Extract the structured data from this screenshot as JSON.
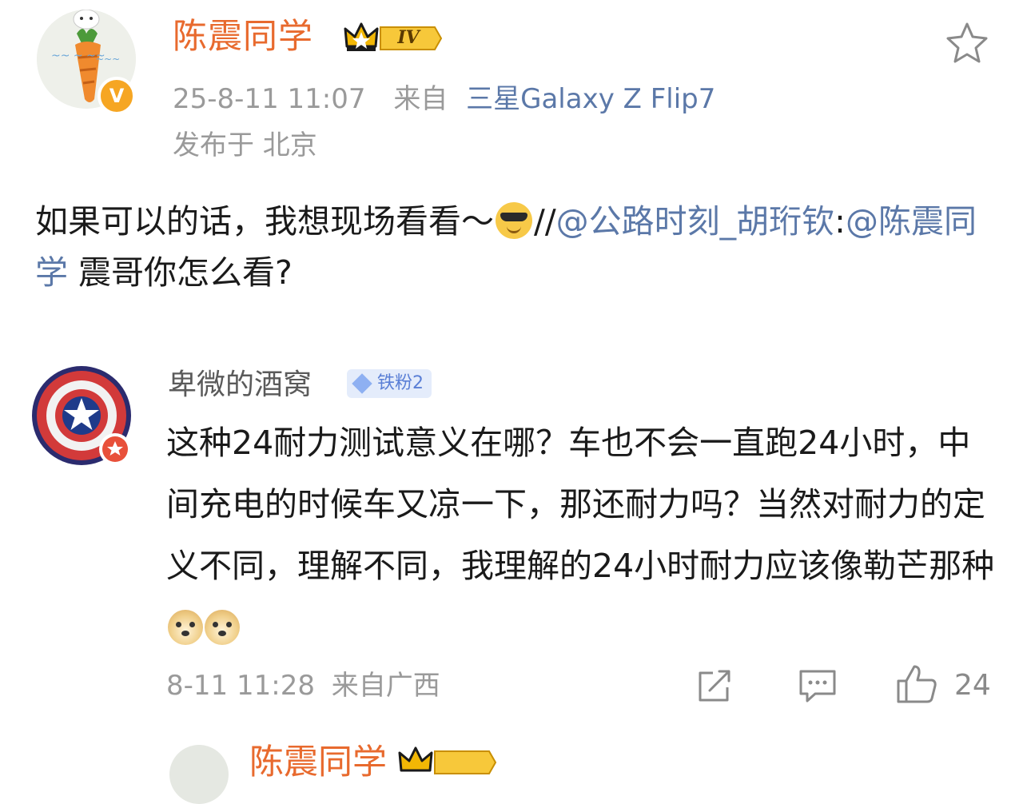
{
  "post": {
    "author": "陈震同学",
    "level": "IV",
    "time": "25-8-11 11:07",
    "source_prefix": "来自",
    "source_device": "三星Galaxy Z Flip7",
    "location": "发布于 北京",
    "body": {
      "text_before": "如果可以的话，我想现场看看～",
      "emoji": "cool-sunglasses-emoji",
      "repost_marker": "//",
      "mention_1": "@公路时刻_胡珩钦",
      "colon": ":",
      "mention_2": "@陈震同学",
      "text_after": " 震哥你怎么看?"
    }
  },
  "reply": {
    "author": "卑微的酒窝",
    "fan_badge": "铁粉2",
    "body": "这种24耐力测试意义在哪？车也不会一直跑24小时，中间充电的时候车又凉一下，那还耐力吗？当然对耐力的定义不同，理解不同，我理解的24小时耐力应该像勒芒那种",
    "emojis": [
      "doge-emoji",
      "doge-emoji"
    ],
    "time": "8-11 11:28",
    "location": "来自广西",
    "like_count": "24"
  },
  "next_item": {
    "author": "陈震同学"
  },
  "icons": {
    "follow": "star-outline-icon",
    "share": "share-icon",
    "comment": "comment-icon",
    "like": "thumbs-up-icon",
    "verify": "verified-v-icon"
  },
  "colors": {
    "author_name": "#e86a2e",
    "link": "#5b78a8",
    "meta": "#9a9a9a",
    "verify_badge": "#f6a623",
    "fan_badge_bg": "#e4ecfb",
    "fan_badge_text": "#5a7fd6"
  }
}
